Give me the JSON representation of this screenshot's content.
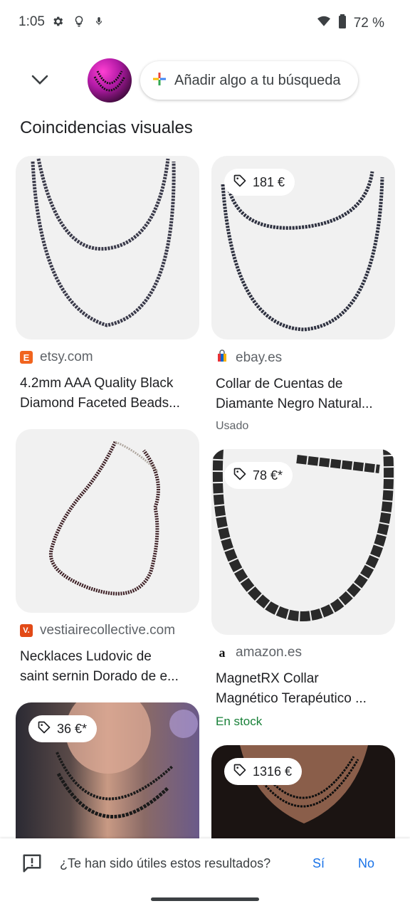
{
  "status_bar": {
    "time": "1:05",
    "battery": "72 %"
  },
  "search": {
    "add_label": "Añadir algo a tu búsqueda"
  },
  "section_title": "Coincidencias visuales",
  "results": [
    {
      "source": "etsy.com",
      "title_line1": "4.2mm AAA Quality Black",
      "title_line2": "Diamond Faceted Beads...",
      "price": "",
      "sub": ""
    },
    {
      "source": "ebay.es",
      "title_line1": "Collar de Cuentas de",
      "title_line2": "Diamante Negro Natural...",
      "price": "181 €",
      "sub": "Usado"
    },
    {
      "source": "vestiairecollective.com",
      "title_line1": "Necklaces Ludovic de",
      "title_line2": "saint sernin Dorado de e...",
      "price": "",
      "sub": ""
    },
    {
      "source": "amazon.es",
      "title_line1": "MagnetRX Collar",
      "title_line2": "Magnético Terapéutico ...",
      "price": "78 €*",
      "sub": "En stock"
    },
    {
      "source": "",
      "title_line1": "",
      "title_line2": "",
      "price": "36 €*",
      "sub": ""
    },
    {
      "source": "",
      "title_line1": "",
      "title_line2": "",
      "price": "1316 €",
      "sub": ""
    }
  ],
  "favicons": {
    "etsy": "E",
    "vestiaire": "V.",
    "amazon": "a"
  },
  "feedback": {
    "question": "¿Te han sido útiles estos resultados?",
    "yes": "Sí",
    "no": "No"
  },
  "colors": {
    "link_blue": "#1a73e8",
    "stock_green": "#188038",
    "etsy_orange": "#f1641e",
    "vestiaire_orange": "#e24a17"
  }
}
